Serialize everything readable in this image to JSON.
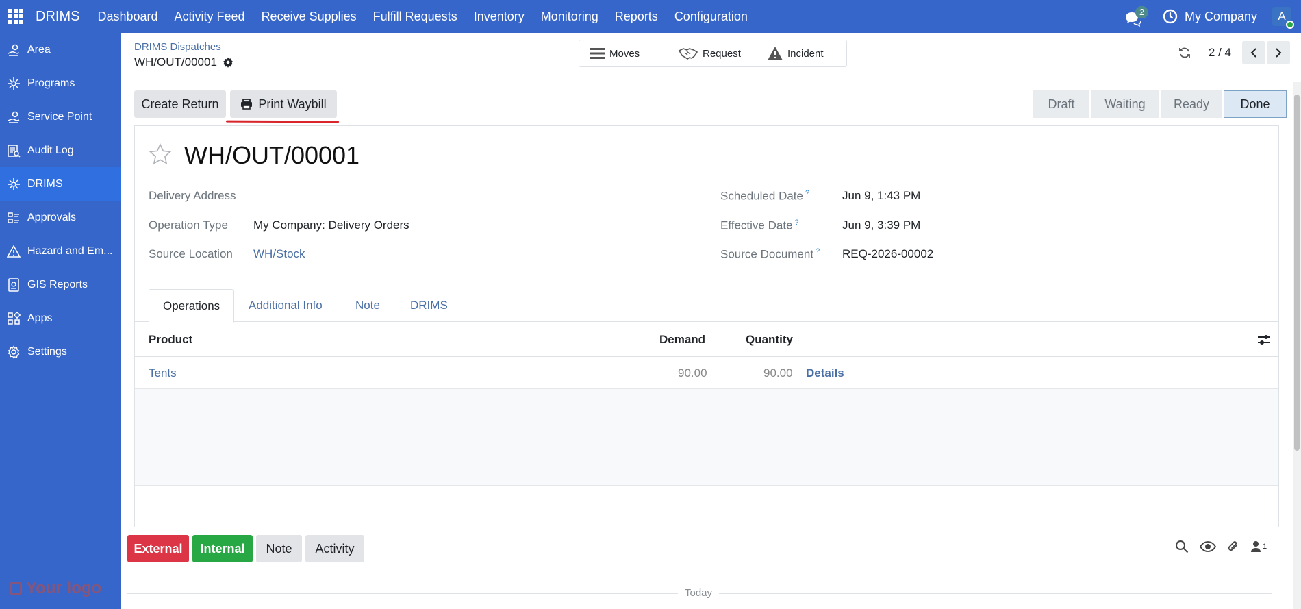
{
  "topnav": {
    "brand": "DRIMS",
    "menu": [
      "Dashboard",
      "Activity Feed",
      "Receive Supplies",
      "Fulfill Requests",
      "Inventory",
      "Monitoring",
      "Reports",
      "Configuration"
    ],
    "chat_count": "2",
    "company": "My Company",
    "avatar_initial": "A"
  },
  "sidebar": {
    "items": [
      {
        "label": "Area",
        "icon": "area-icon"
      },
      {
        "label": "Programs",
        "icon": "programs-icon"
      },
      {
        "label": "Service Point",
        "icon": "service-point-icon"
      },
      {
        "label": "Audit Log",
        "icon": "audit-log-icon"
      },
      {
        "label": "DRIMS",
        "icon": "drims-icon"
      },
      {
        "label": "Approvals",
        "icon": "approvals-icon"
      },
      {
        "label": "Hazard and Em...",
        "icon": "hazard-icon"
      },
      {
        "label": "GIS Reports",
        "icon": "gis-reports-icon"
      },
      {
        "label": "Apps",
        "icon": "apps-icon"
      },
      {
        "label": "Settings",
        "icon": "settings-icon"
      }
    ],
    "logo_text": "Your logo"
  },
  "control": {
    "breadcrumb": "DRIMS Dispatches",
    "record_name": "WH/OUT/00001",
    "smart_buttons": [
      "Moves",
      "Request",
      "Incident"
    ],
    "pager": "2 / 4"
  },
  "actions": {
    "create_return": "Create Return",
    "print_waybill": "Print Waybill"
  },
  "status": {
    "stages": [
      "Draft",
      "Waiting",
      "Ready",
      "Done"
    ],
    "current": "Done"
  },
  "form": {
    "title": "WH/OUT/00001",
    "fields": {
      "delivery_address_label": "Delivery Address",
      "operation_type_label": "Operation Type",
      "operation_type_value": "My Company: Delivery Orders",
      "source_location_label": "Source Location",
      "source_location_value": "WH/Stock",
      "scheduled_date_label": "Scheduled Date",
      "scheduled_date_value": "Jun 9, 1:43 PM",
      "effective_date_label": "Effective Date",
      "effective_date_value": "Jun 9, 3:39 PM",
      "source_document_label": "Source Document",
      "source_document_value": "REQ-2026-00002",
      "help_mark": "?"
    },
    "tabs": [
      "Operations",
      "Additional Info",
      "Note",
      "DRIMS"
    ],
    "table": {
      "headers": {
        "product": "Product",
        "demand": "Demand",
        "quantity": "Quantity"
      },
      "rows": [
        {
          "product": "Tents",
          "demand": "90.00",
          "quantity": "90.00",
          "details": "Details"
        }
      ]
    }
  },
  "chatter": {
    "buttons": [
      "External",
      "Internal",
      "Note",
      "Activity"
    ],
    "follower_count": "1",
    "today": "Today"
  },
  "colors": {
    "brand": "#3666c9",
    "external": "#dc3545",
    "internal": "#28a745",
    "link": "#4a6fa5"
  }
}
